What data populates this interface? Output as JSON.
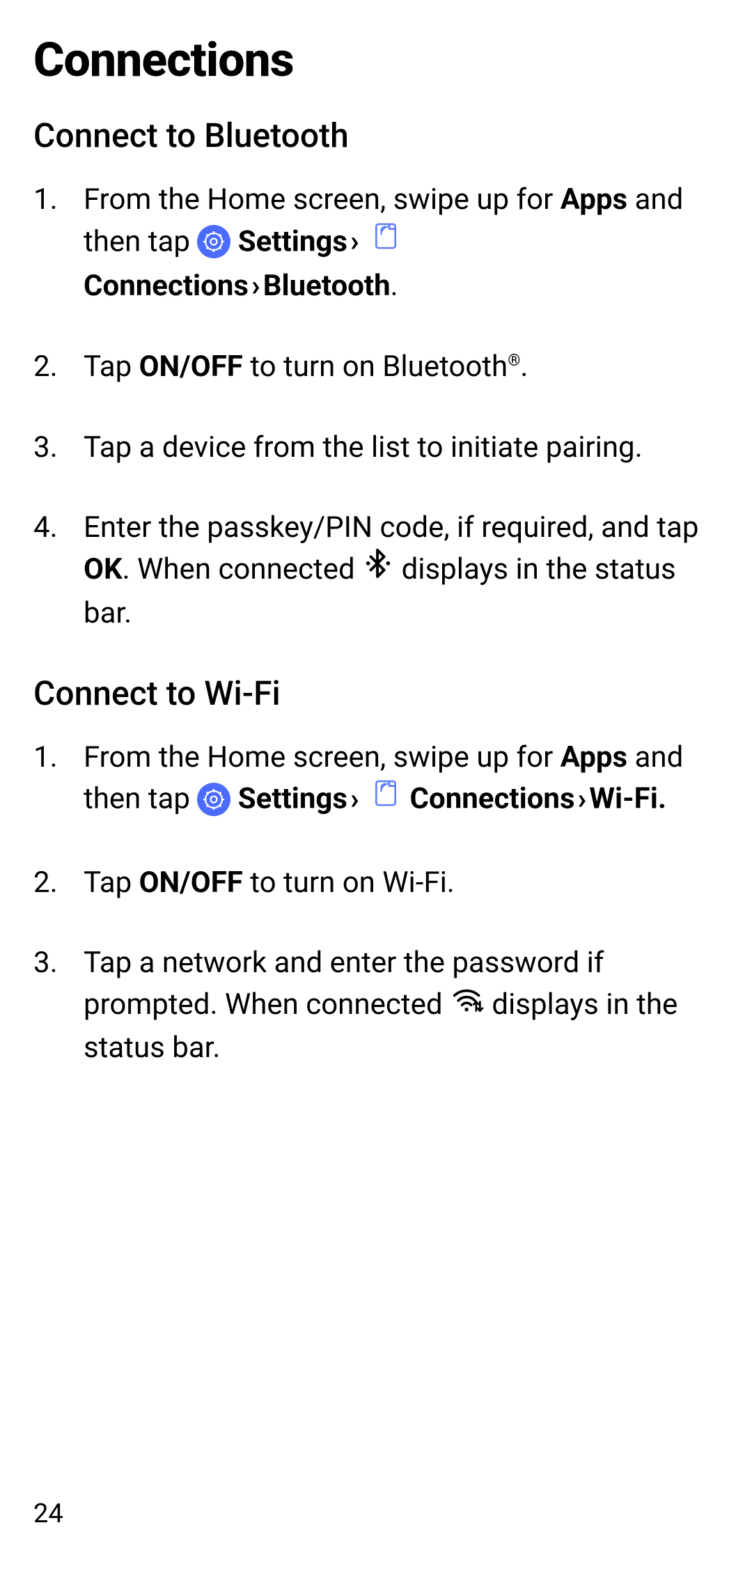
{
  "heading": "Connections",
  "page_number": "24",
  "sections": [
    {
      "title": "Connect to Bluetooth",
      "steps": [
        {
          "pre": "From the Home screen, swipe up for ",
          "b1": "Apps",
          "mid1": " and then tap ",
          "settings_label": "Settings",
          "conn_label": "Connections",
          "target_label": "Bluetooth",
          "trail_period": "."
        },
        {
          "pre": "Tap ",
          "b1": "ON/OFF",
          "mid1": " to turn on Bluetooth",
          "reg": "®",
          "post": "."
        },
        {
          "text": "Tap a device from the list to initiate pairing."
        },
        {
          "pre": "Enter the passkey/PIN code, if required, and tap ",
          "b1": "OK",
          "mid1": ". When connected ",
          "post": " displays in the status bar."
        }
      ]
    },
    {
      "title": "Connect to Wi-Fi",
      "steps": [
        {
          "pre": "From the Home screen, swipe up for ",
          "b1": "Apps",
          "mid1": " and then tap ",
          "settings_label": "Settings",
          "conn_label": "Connections",
          "target_label": "Wi-Fi.",
          "trail_period": ""
        },
        {
          "pre": "Tap ",
          "b1": "ON/OFF",
          "mid1": " to turn on Wi-Fi.",
          "reg": "",
          "post": ""
        },
        {
          "pre": "Tap a network and enter the password if prompted. When connected ",
          "post": " displays in the status bar."
        }
      ]
    }
  ]
}
